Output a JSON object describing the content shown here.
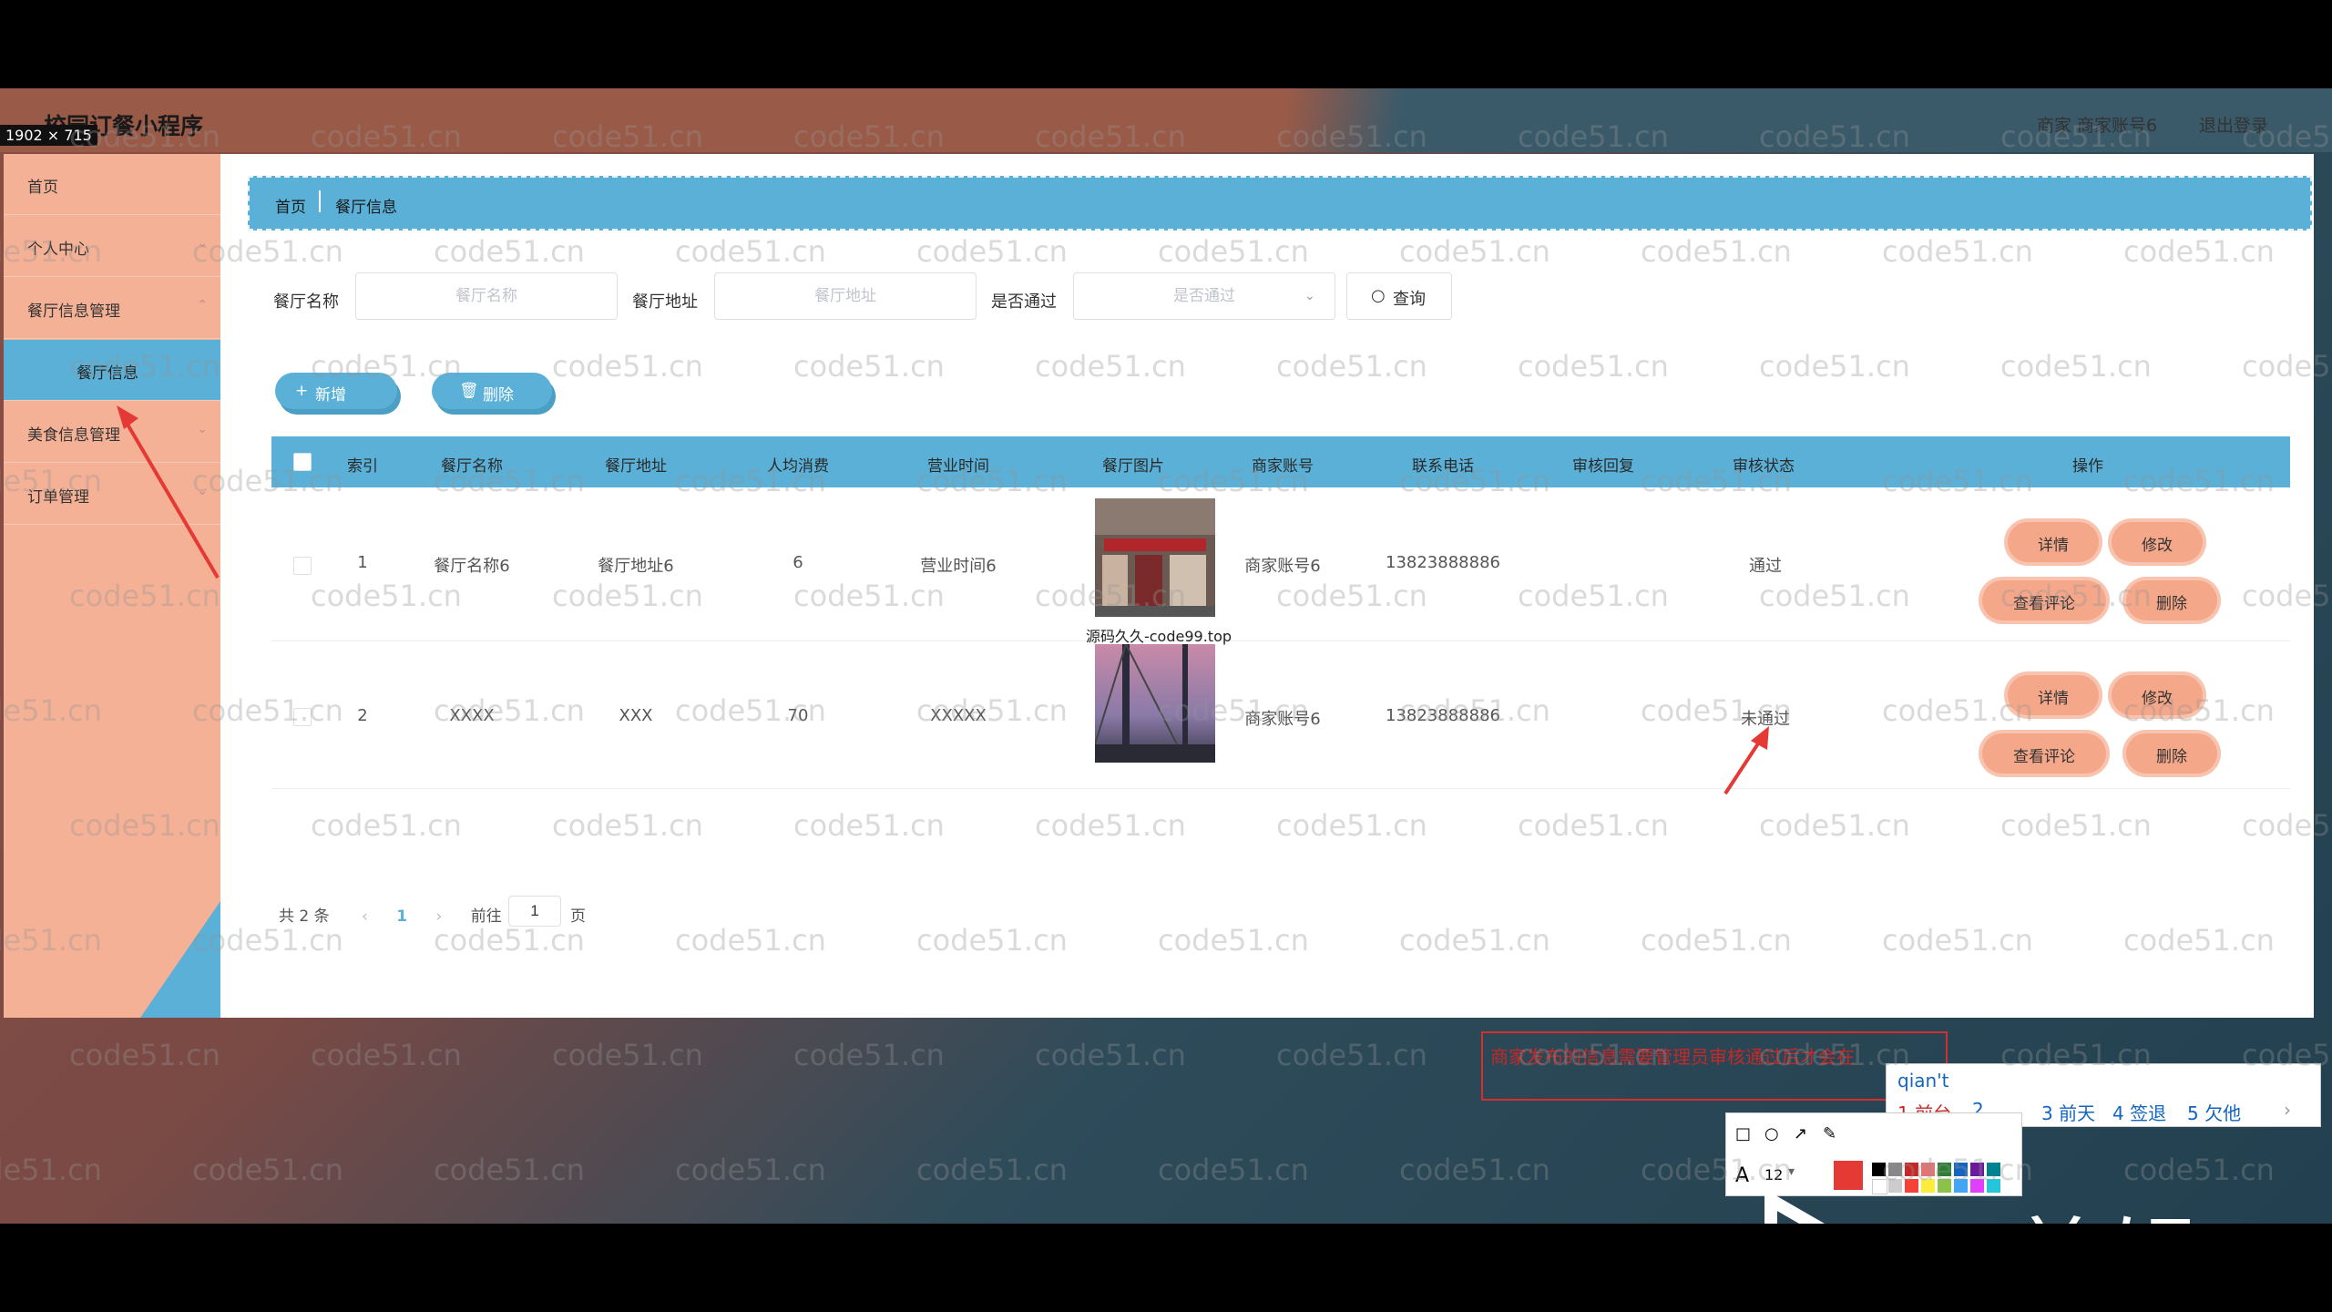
{
  "header": {
    "app_title": "校园订餐小程序",
    "resolution_badge": "1902 × 715",
    "merchant_label": "商家 商家账号6",
    "logout": "退出登录"
  },
  "sidebar": {
    "items": [
      {
        "label": "首页"
      },
      {
        "label": "个人中心"
      },
      {
        "label": "餐厅信息管理"
      },
      {
        "label": "餐厅信息"
      },
      {
        "label": "美食信息管理"
      },
      {
        "label": "订单管理"
      }
    ]
  },
  "breadcrumb": {
    "home": "首页",
    "current": "餐厅信息"
  },
  "filters": {
    "name_label": "餐厅名称",
    "name_placeholder": "餐厅名称",
    "address_label": "餐厅地址",
    "address_placeholder": "餐厅地址",
    "approved_label": "是否通过",
    "approved_placeholder": "是否通过",
    "query_button": "查询"
  },
  "actions": {
    "add": "新增",
    "delete": "删除"
  },
  "table": {
    "headers": [
      "索引",
      "餐厅名称",
      "餐厅地址",
      "人均消费",
      "营业时间",
      "餐厅图片",
      "商家账号",
      "联系电话",
      "审核回复",
      "审核状态",
      "操作"
    ],
    "rows": [
      {
        "index": "1",
        "name": "餐厅名称6",
        "address": "餐厅地址6",
        "avg_cost": "6",
        "hours": "营业时间6",
        "merchant": "商家账号6",
        "phone": "13823888886",
        "reply": "",
        "status": "通过",
        "image_caption": "源码久久-code99.top"
      },
      {
        "index": "2",
        "name": "XXXX",
        "address": "XXX",
        "avg_cost": "70",
        "hours": "XXXXX",
        "merchant": "商家账号6",
        "phone": "13823888886",
        "reply": "",
        "status": "未通过",
        "image_caption": ""
      }
    ],
    "row_actions": {
      "detail": "详情",
      "edit": "修改",
      "comments": "查看评论",
      "delete": "删除"
    }
  },
  "pagination": {
    "total": "共 2 条",
    "current_page": "1",
    "goto_label": "前往",
    "goto_value": "1",
    "page_suffix": "页"
  },
  "annotation": {
    "text": "商家发布的信息需要管理员审核通过后才会在"
  },
  "ime": {
    "typed": "qian't",
    "candidates": [
      "1 前台",
      "2",
      "3 前天",
      "4 签退",
      "5 欠他"
    ]
  },
  "editor": {
    "font_size": "12"
  },
  "watermark": {
    "brand": "eV剪辑",
    "site": "code51.cn"
  },
  "colors": {
    "accent": "#5ab0d6",
    "sidebar": "#f5b195",
    "op_button": "#f5a78a",
    "annotation": "#d32f2f"
  }
}
